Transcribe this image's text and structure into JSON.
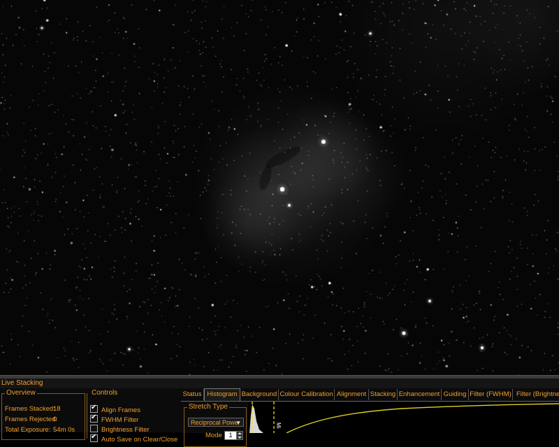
{
  "panel": {
    "title": "Live Stacking"
  },
  "overview": {
    "legend": "Overview",
    "rows": [
      {
        "label": "Frames Stacked:",
        "value": "18"
      },
      {
        "label": "Frames Rejected:",
        "value": "0"
      },
      {
        "label": "Total Exposure:",
        "value": "54m 0s"
      }
    ]
  },
  "controls": {
    "legend": "Controls",
    "items": [
      {
        "label": "Align Frames",
        "checked": true
      },
      {
        "label": "FWHM Filter",
        "checked": true
      },
      {
        "label": "Brightness Filter",
        "checked": false
      },
      {
        "label": "Auto Save on Clear/Close",
        "checked": true
      }
    ]
  },
  "tabs": [
    {
      "label": "Status",
      "active": false
    },
    {
      "label": "Histogram",
      "active": true
    },
    {
      "label": "Background",
      "active": false
    },
    {
      "label": "Colour Calibration",
      "active": false
    },
    {
      "label": "Alignment",
      "active": false
    },
    {
      "label": "Stacking",
      "active": false
    },
    {
      "label": "Enhancement",
      "active": false
    },
    {
      "label": "Guiding",
      "active": false
    },
    {
      "label": "Filter (FWHM)",
      "active": false
    },
    {
      "label": "Filter (Brightness)",
      "active": false
    }
  ],
  "histogram": {
    "stretch_legend": "Stretch Type",
    "stretch_value": "Reciprocal Power",
    "mode_label": "Mode",
    "mode_value": "1",
    "marker_label": "Mi"
  },
  "colors": {
    "accent": "#f0a030",
    "curve": "#e0d020",
    "marker": "#f0e000"
  }
}
